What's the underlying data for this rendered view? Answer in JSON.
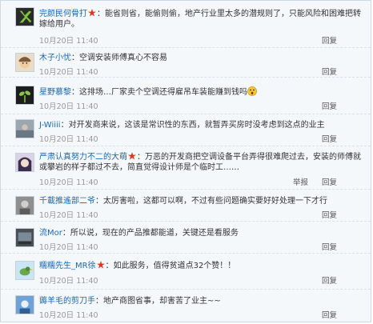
{
  "colors": {
    "name_link": "#1b68b5",
    "vip_badge": "#e8331c",
    "time": "#999999"
  },
  "comments": [
    {
      "name": "完颜民何骨打",
      "vip": true,
      "separator": "：",
      "text": "能省则省，能偷则偷，地产行业里太多的潜规则了，只能风险和困难把转嫁给用户。",
      "time": "10月20日 11:40",
      "reply_label": "回复",
      "avatar_icon": "green-x-icon"
    },
    {
      "name": "木子小忧",
      "vip": false,
      "separator": "：",
      "text": "空调安装师傅真心不容易",
      "time": "10月20日 11:40",
      "reply_label": "回复",
      "avatar_icon": "cartoon-avatar-icon"
    },
    {
      "name": "星野慕黎",
      "vip": false,
      "separator": "：",
      "text": "这排场…厂家卖个空调还得雇吊车装能赚到钱吗",
      "time": "10月20日 11:40",
      "reply_label": "回复",
      "avatar_icon": "sprout-avatar-icon",
      "emoji_icon": "surprised-face-emoji-icon"
    },
    {
      "name": "J-Wiiii",
      "vip": false,
      "separator": "：",
      "text": "对开发商来说，这该是常识性的东西，就暂弄买房时没考虑到这点的业主",
      "time": "10月20日 11:40",
      "reply_label": "回复",
      "avatar_icon": "photo-avatar-icon"
    },
    {
      "name": "严肃认真努力不二的大萌",
      "vip": true,
      "separator": "：",
      "text": "万恶的开发商把空调设备平台弄得很难爬过去，安装的师傅就或攀岩的样子都过不去，简直觉得设计师是个临时工……",
      "time": "10月20日 11:40",
      "report_label": "举报",
      "reply_label": "回复",
      "avatar_icon": "anime-avatar-icon"
    },
    {
      "name": "千載推遙部二爷",
      "vip": false,
      "separator": "：",
      "text": "太厉害啦，这都可以啊，不过有些问题确实要好好处理一下才行",
      "time": "10月20日 11:40",
      "reply_label": "回复",
      "avatar_icon": "gray-photo-avatar-icon"
    },
    {
      "name": "流Mor",
      "vip": false,
      "separator": "：",
      "text": "所以说，现在的产品推都能道，关键还是看服务",
      "time": "10月20日 11:40",
      "reply_label": "回复",
      "avatar_icon": "dark-photo-avatar-icon"
    },
    {
      "name": "糯糯先生_MR徐",
      "vip": true,
      "separator": "：",
      "text": "如此服务，值得贫道点32个赞！！",
      "time": "10月20日 11:40",
      "reply_label": "回复",
      "avatar_icon": "bird-avatar-icon"
    },
    {
      "name": "薅羊毛的剪刀手",
      "vip": false,
      "separator": "：",
      "text": "地产商图省事，却害苦了业主~~",
      "time": "10月20日 11:40",
      "reply_label": "回复",
      "avatar_icon": "blue-avatar-icon"
    }
  ]
}
